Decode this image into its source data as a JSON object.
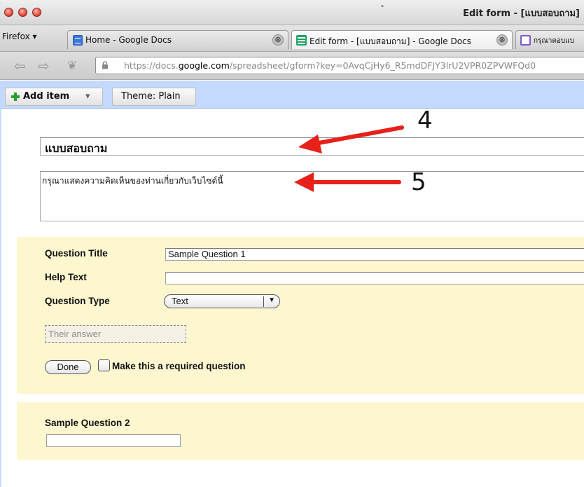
{
  "window": {
    "title": "Edit form - [แบบสอบถาม]",
    "stray_mark": "ู"
  },
  "tabs": {
    "firefox_menu": "Firefox ▾",
    "items": [
      {
        "label": "Home - Google Docs",
        "icon": "docs-icon",
        "close": "⊗"
      },
      {
        "label": "Edit form - [แบบสอบถาม] - Google Docs",
        "icon": "spreadsheet-icon",
        "close": "⊗",
        "active": true
      },
      {
        "label": "กรุณาตอบแบ",
        "icon": "form-icon"
      }
    ]
  },
  "nav": {
    "back": "⇦",
    "forward": "⇨",
    "bookmark": "❦",
    "url_prefix": "https://docs.",
    "url_domain": "google.com",
    "url_rest": "/spreadsheet/gform?key=0AvqCjHy6_R5mdDFJY3lrU2VPR0ZPVWFQd0"
  },
  "toolbar": {
    "add_item": "Add item",
    "add_item_caret": "▾",
    "theme": "Theme: Plain"
  },
  "form": {
    "title": "แบบสอบถาม",
    "description": "กรุณาแสดงความคิดเห็นของท่านเกี่ยวกับเว็บไซต์นี้"
  },
  "question1": {
    "title_label": "Question Title",
    "title_value": "Sample Question 1",
    "help_label": "Help Text",
    "help_value": "",
    "type_label": "Question Type",
    "type_value": "Text",
    "type_arrow": "▼",
    "answer_placeholder": "Their answer",
    "done_label": "Done",
    "required_label": "Make this a required question",
    "required_checked": false
  },
  "question2": {
    "title": "Sample Question 2"
  },
  "annotations": {
    "callout_4": "4",
    "callout_5": "5",
    "arrow_color": "#e8201a"
  }
}
